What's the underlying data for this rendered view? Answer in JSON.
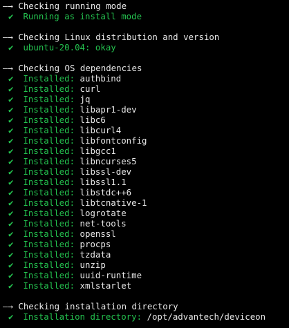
{
  "colors": {
    "background": "#000000",
    "heading": "#e8e8e8",
    "success": "#24c24f",
    "value": "#e8e8e8"
  },
  "icons": {
    "section_marker": "arrow-right-icon",
    "status_marker": "checkmark-icon"
  },
  "arrow_glyph": "—→",
  "check_glyph": "✔",
  "sections": [
    {
      "heading": "Checking running mode",
      "lines": [
        {
          "label": "Running as install mode",
          "value": ""
        }
      ]
    },
    {
      "heading": "Checking Linux distribution and version",
      "lines": [
        {
          "label": "ubuntu-20.04: okay",
          "value": ""
        }
      ]
    },
    {
      "heading": "Checking OS dependencies",
      "lines": [
        {
          "label": "Installed: ",
          "value": "authbind"
        },
        {
          "label": "Installed: ",
          "value": "curl"
        },
        {
          "label": "Installed: ",
          "value": "jq"
        },
        {
          "label": "Installed: ",
          "value": "libapr1-dev"
        },
        {
          "label": "Installed: ",
          "value": "libc6"
        },
        {
          "label": "Installed: ",
          "value": "libcurl4"
        },
        {
          "label": "Installed: ",
          "value": "libfontconfig"
        },
        {
          "label": "Installed: ",
          "value": "libgcc1"
        },
        {
          "label": "Installed: ",
          "value": "libncurses5"
        },
        {
          "label": "Installed: ",
          "value": "libssl-dev"
        },
        {
          "label": "Installed: ",
          "value": "libssl1.1"
        },
        {
          "label": "Installed: ",
          "value": "libstdc++6"
        },
        {
          "label": "Installed: ",
          "value": "libtcnative-1"
        },
        {
          "label": "Installed: ",
          "value": "logrotate"
        },
        {
          "label": "Installed: ",
          "value": "net-tools"
        },
        {
          "label": "Installed: ",
          "value": "openssl"
        },
        {
          "label": "Installed: ",
          "value": "procps"
        },
        {
          "label": "Installed: ",
          "value": "tzdata"
        },
        {
          "label": "Installed: ",
          "value": "unzip"
        },
        {
          "label": "Installed: ",
          "value": "uuid-runtime"
        },
        {
          "label": "Installed: ",
          "value": "xmlstarlet"
        }
      ]
    },
    {
      "heading": "Checking installation directory",
      "lines": [
        {
          "label": "Installation directory: ",
          "value": "/opt/advantech/deviceon"
        }
      ]
    }
  ]
}
